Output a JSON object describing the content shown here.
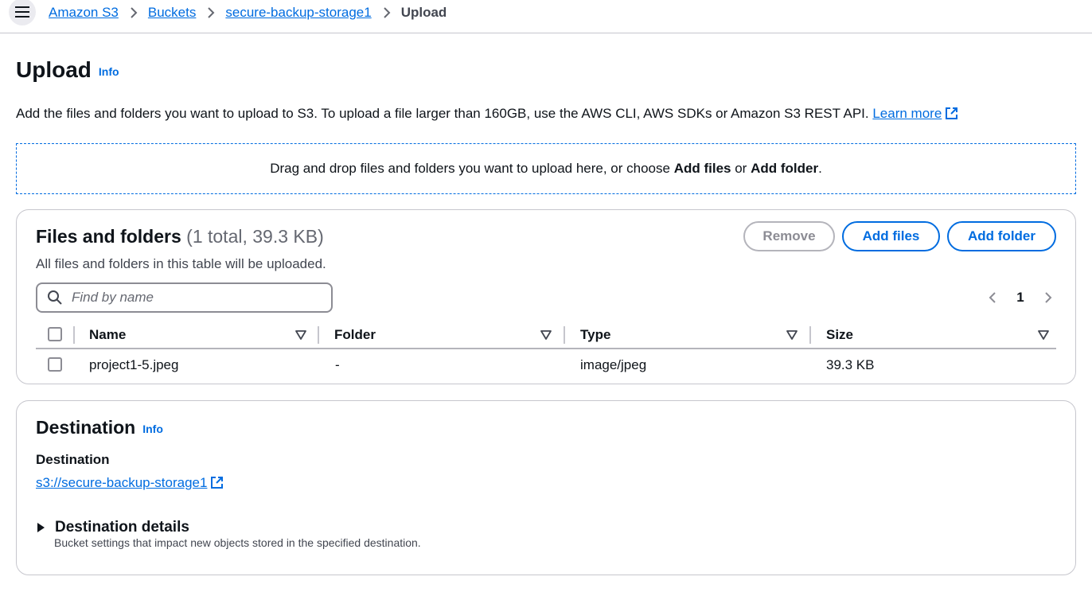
{
  "breadcrumb": {
    "items": [
      "Amazon S3",
      "Buckets",
      "secure-backup-storage1"
    ],
    "current": "Upload"
  },
  "header": {
    "title": "Upload",
    "info": "Info",
    "description": "Add the files and folders you want to upload to S3. To upload a file larger than 160GB, use the AWS CLI, AWS SDKs or Amazon S3 REST API.",
    "learn_more": "Learn more"
  },
  "dropzone": {
    "text_before": "Drag and drop files and folders you want to upload here, or choose",
    "add_files": "Add files",
    "or": "or",
    "add_folder": "Add folder",
    "period": "."
  },
  "files_panel": {
    "title": "Files and folders",
    "count": "(1 total, 39.3 KB)",
    "subtitle": "All files and folders in this table will be uploaded.",
    "buttons": {
      "remove": "Remove",
      "add_files": "Add files",
      "add_folder": "Add folder"
    },
    "search_placeholder": "Find by name",
    "page": "1",
    "columns": [
      "Name",
      "Folder",
      "Type",
      "Size"
    ],
    "rows": [
      {
        "name": "project1-5.jpeg",
        "folder": "-",
        "type": "image/jpeg",
        "size": "39.3 KB"
      }
    ]
  },
  "destination": {
    "title": "Destination",
    "info": "Info",
    "label": "Destination",
    "link": "s3://secure-backup-storage1",
    "details_label": "Destination details",
    "details_desc": "Bucket settings that impact new objects stored in the specified destination."
  },
  "colors": {
    "link": "#006ce0",
    "text": "#0f141a",
    "border": "#c6c6cd",
    "disabled": "#8c8c94"
  },
  "icons": [
    "menu-icon",
    "chevron-right-icon",
    "external-link-icon",
    "search-icon",
    "chevron-left-icon",
    "sort-icon",
    "caret-right-icon"
  ]
}
